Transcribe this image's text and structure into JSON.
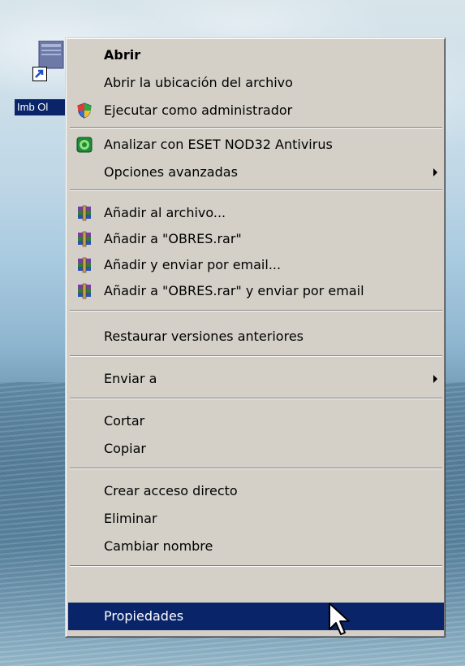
{
  "desktop": {
    "icon_label": "Imb Ol"
  },
  "menu": {
    "items": [
      {
        "label": "Abrir",
        "bold": true
      },
      {
        "label": "Abrir la ubicación del archivo"
      },
      {
        "label": "Ejecutar como administrador",
        "icon": "uac-shield-icon"
      },
      {
        "label": "Analizar con ESET NOD32 Antivirus",
        "icon": "eset-icon"
      },
      {
        "label": "Opciones avanzadas",
        "submenu": true
      },
      {
        "label": "Añadir al archivo...",
        "icon": "winrar-icon"
      },
      {
        "label": "Añadir a \"OBRES.rar\"",
        "icon": "winrar-icon"
      },
      {
        "label": "Añadir y enviar por email...",
        "icon": "winrar-icon"
      },
      {
        "label": "Añadir a \"OBRES.rar\" y enviar por email",
        "icon": "winrar-icon"
      },
      {
        "label": "Restaurar versiones anteriores"
      },
      {
        "label": "Enviar a",
        "submenu": true
      },
      {
        "label": "Cortar"
      },
      {
        "label": "Copiar"
      },
      {
        "label": "Crear acceso directo"
      },
      {
        "label": "Eliminar"
      },
      {
        "label": "Cambiar nombre"
      },
      {
        "label": "Propiedades",
        "selected": true
      }
    ]
  },
  "colors": {
    "menu_bg": "#d4d0c8",
    "selection": "#0a246a",
    "selection_text": "#ffffff"
  }
}
